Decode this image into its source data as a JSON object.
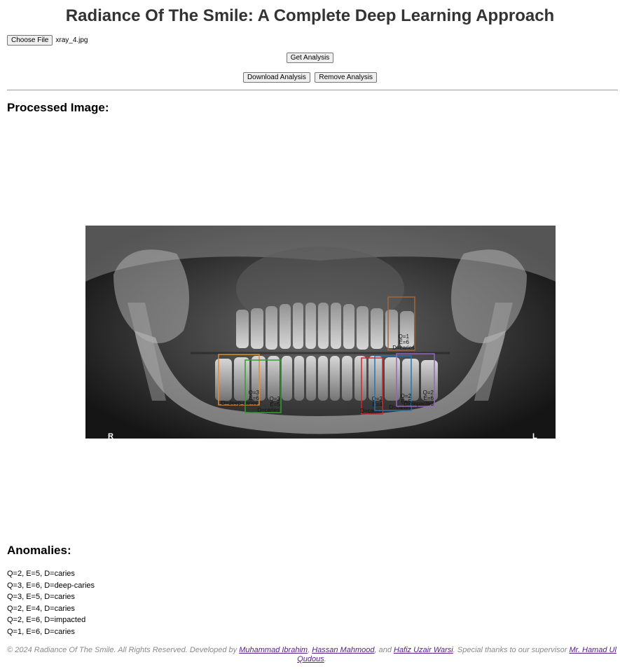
{
  "page": {
    "title": "Radiance Of The Smile: A Complete Deep Learning Approach"
  },
  "upload": {
    "choose_label": "Choose File",
    "file_name": "xray_4.jpg"
  },
  "actions": {
    "get_analysis": "Get Analysis",
    "download_analysis": "Download Analysis",
    "remove_analysis": "Remove Analysis"
  },
  "processed": {
    "heading": "Processed Image:",
    "corner_left": "R",
    "corner_right": "L",
    "boxes": [
      {
        "q": "Q=1",
        "e": "E=6",
        "d": "D=caries",
        "color": "#a0673a"
      },
      {
        "q": "Q=3",
        "e": "E=6",
        "d": "D=deep-caries",
        "color": "#e68a2e"
      },
      {
        "q": "Q=3",
        "e": "E=5",
        "d": "D=caries",
        "color": "#2ca02c"
      },
      {
        "q": "Q=2",
        "e": "E=4",
        "d": "D=caries",
        "color": "#d62728"
      },
      {
        "q": "Q=2",
        "e": "E=5",
        "d": "D=caries",
        "color": "#1f77b4"
      },
      {
        "q": "Q=2",
        "e": "E=6",
        "d": "D=impacted",
        "color": "#9467bd"
      }
    ]
  },
  "anomalies": {
    "heading": "Anomalies:",
    "items": [
      "Q=2, E=5, D=caries",
      "Q=3, E=6, D=deep-caries",
      "Q=3, E=5, D=caries",
      "Q=2, E=4, D=caries",
      "Q=2, E=6, D=impacted",
      "Q=1, E=6, D=caries"
    ]
  },
  "footer": {
    "prefix": "© 2024 Radiance Of The Smile. All Rights Reserved. Developed by ",
    "author1": "Muhammad Ibrahim",
    "sep1": ", ",
    "author2": "Hassan Mahmood",
    "sep2": ", and ",
    "author3": "Hafiz Uzair Warsi",
    "mid": ". Special thanks to our supervisor ",
    "supervisor": "Mr. Hamad Ul Qudous",
    "suffix": "."
  }
}
